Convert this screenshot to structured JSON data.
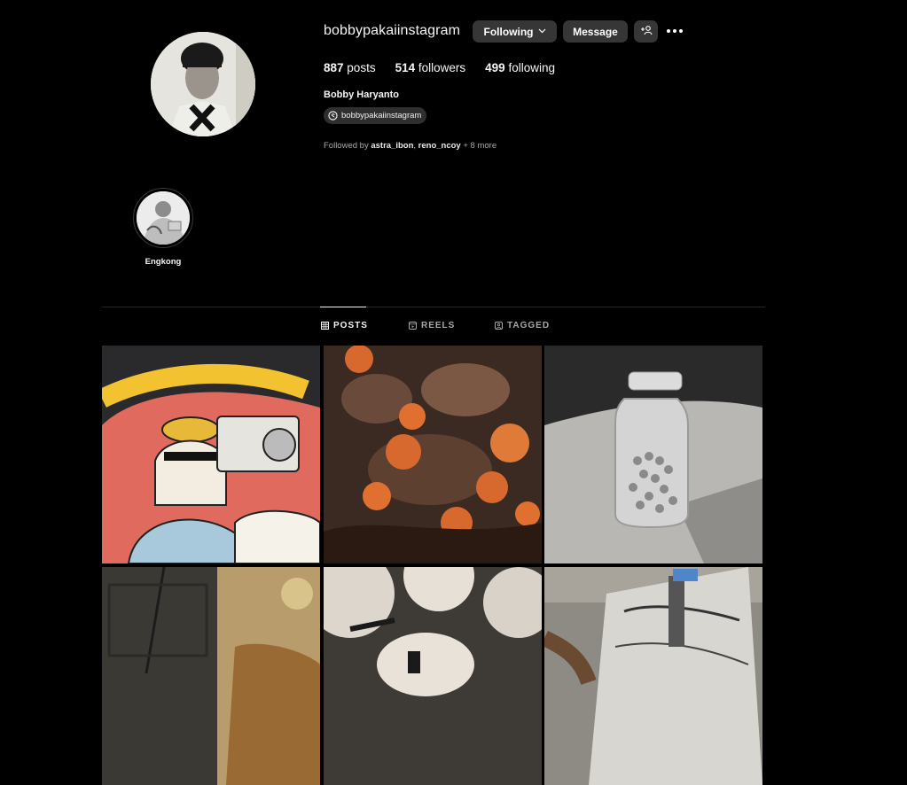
{
  "profile": {
    "username": "bobbypakaiinstagram",
    "full_name": "Bobby Haryanto",
    "threads_handle": "bobbypakaiinstagram",
    "following_button": "Following",
    "message_button": "Message",
    "stats": {
      "posts_count": "887",
      "posts_label": "posts",
      "followers_count": "514",
      "followers_label": "followers",
      "following_count": "499",
      "following_label": "following"
    },
    "followed_by": {
      "prefix": "Followed by",
      "user1": "astra_ibon",
      "separator": ",",
      "user2": "reno_ncoy",
      "more": "+ 8 more"
    }
  },
  "highlights": [
    {
      "label": "Engkong"
    }
  ],
  "tabs": {
    "posts": "POSTS",
    "reels": "REELS",
    "tagged": "TAGGED",
    "active": "posts"
  },
  "icons": {
    "threads": "threads-icon",
    "add_user": "add-user-icon",
    "more": "more-options-icon",
    "grid": "grid-icon",
    "reels": "reels-icon",
    "tagged": "tagged-icon"
  },
  "colors": {
    "background": "#000000",
    "button": "#363636",
    "muted_text": "#a8a8a8",
    "divider": "#262626"
  }
}
